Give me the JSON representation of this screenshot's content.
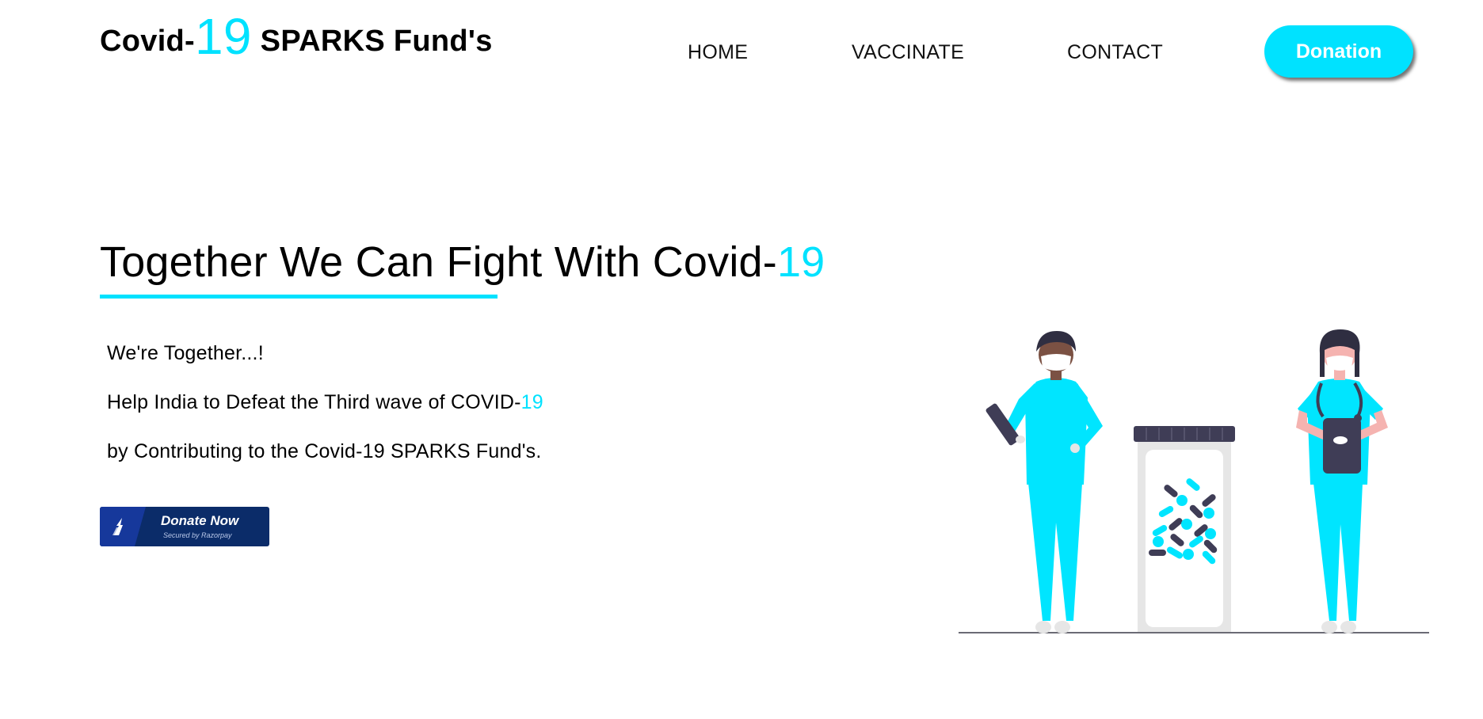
{
  "header": {
    "logo_prefix": "Covid-",
    "logo_number": "19",
    "logo_suffix": " SPARKS Fund's",
    "nav": {
      "home": "HOME",
      "vaccinate": "VACCINATE",
      "contact": "CONTACT"
    },
    "donation_button": "Donation"
  },
  "hero": {
    "title_main": "Together We Can Fight With Covid-",
    "title_accent": "19",
    "line1": "We're Together...!",
    "line2_main": "Help India to Defeat the Third wave of COVID-",
    "line2_accent": "19",
    "line3": "by Contributing to the Covid-19 SPARKS Fund's."
  },
  "razorpay_button": {
    "label": "Donate Now",
    "sublabel": "Secured by Razorpay"
  },
  "illustration": {
    "icon": "doctors-medicine-jar-illustration"
  },
  "colors": {
    "accent": "#00e2ff",
    "razorpay_dark": "#0b2c69",
    "razorpay_blue": "#16389b",
    "scrubs": "#00e5ff",
    "dark": "#3f3d56"
  }
}
